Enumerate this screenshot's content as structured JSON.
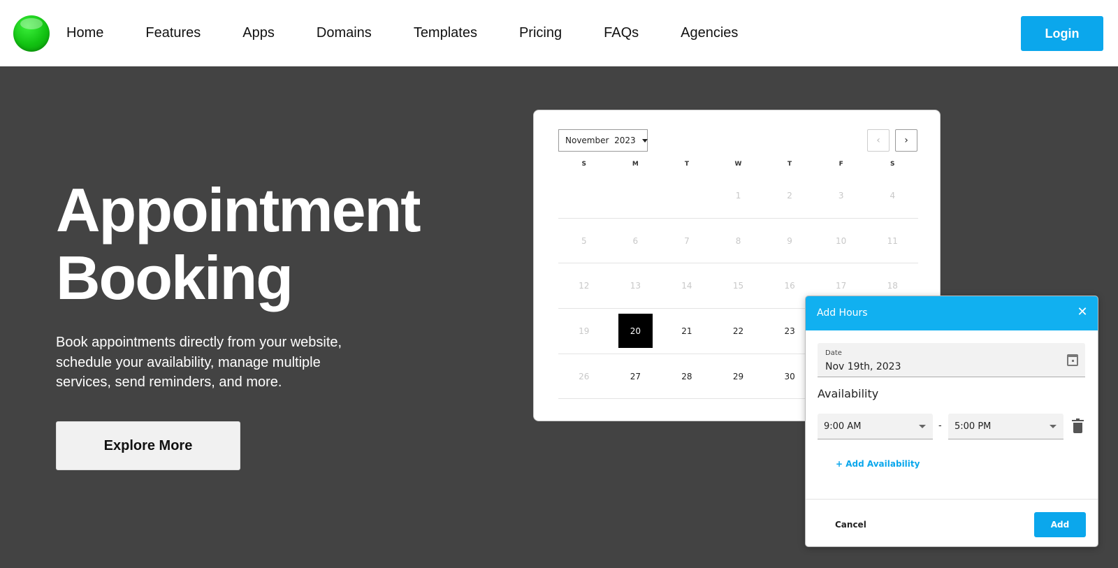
{
  "nav": {
    "items": [
      "Home",
      "Features",
      "Apps",
      "Domains",
      "Templates",
      "Pricing",
      "FAQs",
      "Agencies"
    ],
    "login_label": "Login"
  },
  "hero": {
    "title_line1": "Appointment",
    "title_line2": "Booking",
    "description": "Book appointments directly from your website, schedule your availability, manage multiple services, send reminders, and more.",
    "cta_label": "Explore More"
  },
  "calendar": {
    "month": "November",
    "year": "2023",
    "prev_icon": "chevron-left-icon",
    "next_icon": "chevron-right-icon",
    "days_of_week": [
      "S",
      "M",
      "T",
      "W",
      "T",
      "F",
      "S"
    ],
    "weeks": [
      [
        null,
        null,
        null,
        "1",
        "2",
        "3",
        "4"
      ],
      [
        "5",
        "6",
        "7",
        "8",
        "9",
        "10",
        "11"
      ],
      [
        "12",
        "13",
        "14",
        "15",
        "16",
        "17",
        "18"
      ],
      [
        "19",
        "20",
        "21",
        "22",
        "23",
        null,
        null
      ],
      [
        "26",
        "27",
        "28",
        "29",
        "30",
        null,
        null
      ]
    ],
    "muted_days": [
      "1",
      "2",
      "3",
      "4",
      "5",
      "6",
      "7",
      "8",
      "9",
      "10",
      "11",
      "12",
      "13",
      "14",
      "15",
      "16",
      "17",
      "18",
      "19",
      "26"
    ],
    "selected_day": "20"
  },
  "dialog": {
    "title": "Add Hours",
    "close_icon": "close-icon",
    "date_label": "Date",
    "date_value": "Nov 19th, 2023",
    "availability_label": "Availability",
    "start_time": "9:00 AM",
    "separator": "-",
    "end_time": "5:00 PM",
    "add_availability_label": "+ Add Availability",
    "cancel_label": "Cancel",
    "add_label": "Add"
  },
  "colors": {
    "accent": "#0ba7ec",
    "dialog_header": "#11b0f0",
    "hero_background": "#434343",
    "logo_green": "#12c212"
  }
}
